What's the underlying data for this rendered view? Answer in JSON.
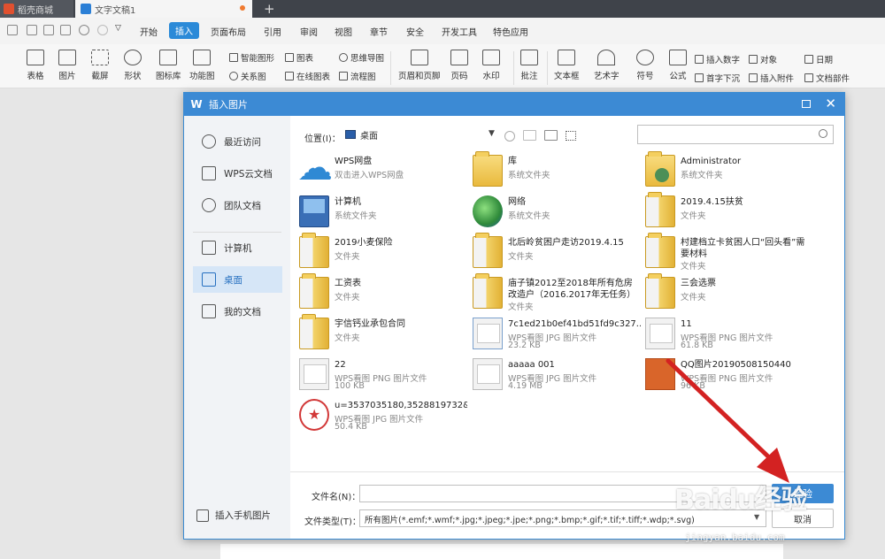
{
  "tabs": [
    {
      "label": "稻壳商城"
    },
    {
      "label": "文字文稿1"
    }
  ],
  "menu": [
    "开始",
    "插入",
    "页面布局",
    "引用",
    "审阅",
    "视图",
    "章节",
    "安全",
    "开发工具",
    "特色应用"
  ],
  "ribbon": {
    "big": [
      "表格",
      "图片",
      "截屏",
      "形状",
      "图标库",
      "功能图",
      "页眉和页脚",
      "页码",
      "水印",
      "批注",
      "文本框",
      "艺术字",
      "符号",
      "公式"
    ],
    "small": [
      "智能图形",
      "图表",
      "思维导图",
      "关系图",
      "在线图表",
      "流程图",
      "插入数字",
      "对象",
      "日期",
      "首字下沉",
      "插入附件",
      "文档部件"
    ]
  },
  "dialog": {
    "title": "插入图片",
    "sidebar": [
      "最近访问",
      "WPS云文档",
      "团队文档",
      "计算机",
      "桌面",
      "我的文档"
    ],
    "sidebar_bottom": "插入手机图片",
    "location_label": "位置(I)：",
    "location_value": "桌面",
    "files": [
      {
        "name": "WPS网盘",
        "sub": "双击进入WPS网盘",
        "sub2": ""
      },
      {
        "name": "库",
        "sub": "系统文件夹",
        "sub2": ""
      },
      {
        "name": "Administrator",
        "sub": "系统文件夹",
        "sub2": ""
      },
      {
        "name": "计算机",
        "sub": "系统文件夹",
        "sub2": ""
      },
      {
        "name": "网络",
        "sub": "系统文件夹",
        "sub2": ""
      },
      {
        "name": "2019.4.15扶贫",
        "sub": "文件夹",
        "sub2": ""
      },
      {
        "name": "2019小麦保险",
        "sub": "文件夹",
        "sub2": ""
      },
      {
        "name": "北后岭贫困户走访2019.4.15",
        "sub": "文件夹",
        "sub2": ""
      },
      {
        "name": "村建档立卡贫困人口“回头看”需要材料",
        "sub": "",
        "sub2": "文件夹"
      },
      {
        "name": "工资表",
        "sub": "文件夹",
        "sub2": ""
      },
      {
        "name": "庙子镇2012至2018年所有危房改造户（2016.2017年无任务）",
        "sub": "",
        "sub2": "文件夹"
      },
      {
        "name": "三会选票",
        "sub": "文件夹",
        "sub2": ""
      },
      {
        "name": "宇信钙业承包合同",
        "sub": "文件夹",
        "sub2": ""
      },
      {
        "name": "7c1ed21b0ef41bd51fd9c327...",
        "sub": "WPS看图 JPG 图片文件",
        "sub2": "23.2 KB"
      },
      {
        "name": "11",
        "sub": "WPS看图 PNG 图片文件",
        "sub2": "61.8 KB"
      },
      {
        "name": "22",
        "sub": "WPS看图 PNG 图片文件",
        "sub2": "100 KB"
      },
      {
        "name": "aaaaa 001",
        "sub": "WPS看图 JPG 图片文件",
        "sub2": "4.19 MB"
      },
      {
        "name": "QQ图片20190508150440",
        "sub": "WPS看图 PNG 图片文件",
        "sub2": "96 KB"
      },
      {
        "name": "u=3537035180,3528819732&...",
        "sub": "WPS看图 JPG 图片文件",
        "sub2": "50.4 KB"
      }
    ],
    "filename_label": "文件名(N)：",
    "filename_value": "",
    "filetype_label": "文件类型(T)：",
    "filetype_value": "所有图片(*.emf;*.wmf;*.jpg;*.jpeg;*.jpe;*.png;*.bmp;*.gif;*.tif;*.tiff;*.wdp;*.svg)",
    "open_button": "经验",
    "cancel_button": "取消"
  },
  "watermark": {
    "main": "Baidu经验",
    "sub": "jingyan.baidu.com"
  },
  "colors": {
    "accent": "#3c8ad4",
    "arrow": "#d32222"
  }
}
